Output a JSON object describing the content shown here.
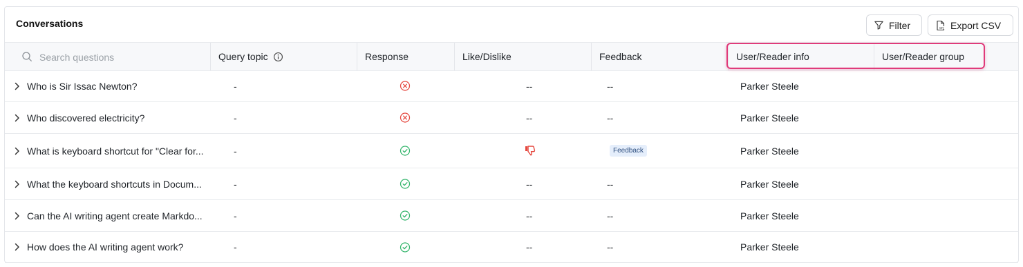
{
  "header": {
    "title": "Conversations",
    "filter_label": "Filter",
    "export_label": "Export CSV"
  },
  "search": {
    "placeholder": "Search questions"
  },
  "columns": {
    "query_topic": "Query topic",
    "response": "Response",
    "like_dislike": "Like/Dislike",
    "feedback": "Feedback",
    "user_info": "User/Reader info",
    "user_group": "User/Reader group"
  },
  "colors": {
    "accent_highlight": "#e03b7a",
    "error": "#e5483f",
    "success": "#33b56b",
    "dislike": "#e5483f"
  },
  "rows": [
    {
      "question": "Who is Sir Issac Newton?",
      "topic": "-",
      "response": "x-circle-icon",
      "like": "--",
      "feedback": "--",
      "user": "Parker Steele"
    },
    {
      "question": "Who discovered electricity?",
      "topic": "-",
      "response": "x-circle-icon",
      "like": "--",
      "feedback": "--",
      "user": "Parker Steele"
    },
    {
      "question": "What is keyboard shortcut for \"Clear for...",
      "topic": "-",
      "response": "check-circle-icon",
      "like": "thumbs-down-icon",
      "feedback": "Feedback",
      "user": "Parker Steele"
    },
    {
      "question": "What the keyboard shortcuts in Docum...",
      "topic": "-",
      "response": "check-circle-icon",
      "like": "--",
      "feedback": "--",
      "user": "Parker Steele"
    },
    {
      "question": "Can the AI writing agent create Markdo...",
      "topic": "-",
      "response": "check-circle-icon",
      "like": "--",
      "feedback": "--",
      "user": "Parker Steele"
    },
    {
      "question": "How does the AI writing agent work?",
      "topic": "-",
      "response": "check-circle-icon",
      "like": "--",
      "feedback": "--",
      "user": "Parker Steele"
    }
  ]
}
